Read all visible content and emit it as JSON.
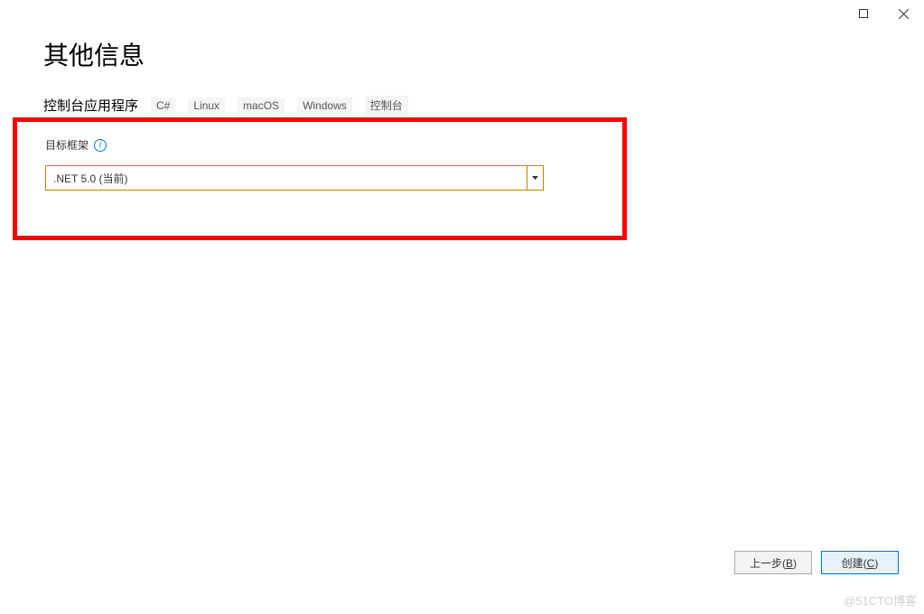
{
  "window": {
    "title": "其他信息"
  },
  "subtitle": {
    "text": "控制台应用程序",
    "tags": [
      "C#",
      "Linux",
      "macOS",
      "Windows",
      "控制台"
    ]
  },
  "form": {
    "framework_label": "目标框架",
    "framework_value": ".NET 5.0 (当前)"
  },
  "footer": {
    "back_label": "上一步(",
    "back_hotkey": "B",
    "back_suffix": ")",
    "create_label": "创建(",
    "create_hotkey": "C",
    "create_suffix": ")"
  },
  "watermark": "@51CTO博客",
  "highlight": {
    "color": "#ff0000",
    "targets": [
      "target-framework-field"
    ]
  }
}
